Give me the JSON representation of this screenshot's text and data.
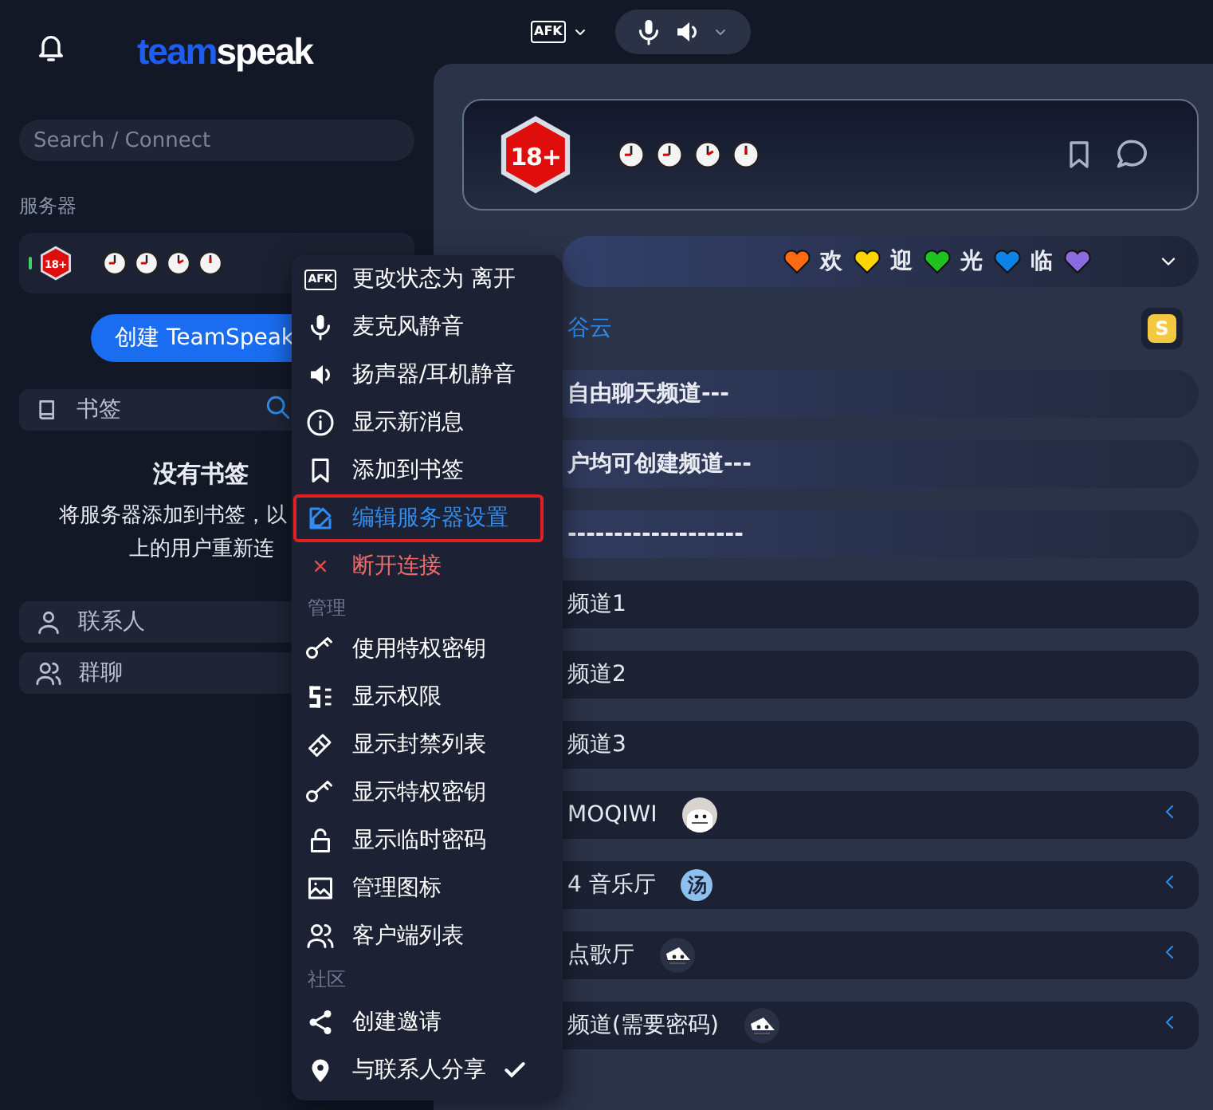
{
  "sidebar": {
    "logo": {
      "first": "team",
      "second": "speak"
    },
    "search": {
      "placeholder": "Search / Connect"
    },
    "servers_label": "服务器",
    "server": {
      "badge": "18+"
    },
    "create_button": "创建 TeamSpeak",
    "bookmarks": {
      "title": "书签",
      "empty_title": "没有书签",
      "empty_lines": [
        "将服务器添加到书签，以",
        "上的用户重新连"
      ]
    },
    "sections": [
      {
        "label": "联系人"
      },
      {
        "label": "群聊"
      }
    ]
  },
  "topbar": {
    "status_label": "AFK"
  },
  "server_header": {
    "badge": "18+"
  },
  "banner": {
    "segments": [
      {
        "kind": "heart",
        "color": "#ff6a13"
      },
      {
        "kind": "text",
        "text": "欢"
      },
      {
        "kind": "heart",
        "color": "#ffd500"
      },
      {
        "kind": "text",
        "text": "迎"
      },
      {
        "kind": "heart",
        "color": "#1fc31f"
      },
      {
        "kind": "text",
        "text": "光"
      },
      {
        "kind": "heart",
        "color": "#0a84e8"
      },
      {
        "kind": "text",
        "text": "临"
      },
      {
        "kind": "heart",
        "color": "#8c6be0"
      }
    ]
  },
  "channels": [
    {
      "kind": "server",
      "name": "谷云",
      "badge": "S"
    },
    {
      "kind": "spacer",
      "name": "自由聊天频道---"
    },
    {
      "kind": "spacer",
      "name": "户均可创建频道---"
    },
    {
      "kind": "spacer",
      "name": "-------------------"
    },
    {
      "kind": "channel",
      "name": "频道1",
      "collapsed": false
    },
    {
      "kind": "channel",
      "name": "频道2",
      "collapsed": false
    },
    {
      "kind": "channel",
      "name": "频道3",
      "collapsed": false
    },
    {
      "kind": "channel",
      "name": "MOQIWI",
      "collapsed": true
    },
    {
      "kind": "channel",
      "name": "4 音乐厅",
      "collapsed": true,
      "avatar": {
        "kind": "letter",
        "text": "汤"
      }
    },
    {
      "kind": "channel",
      "name": "点歌厅",
      "collapsed": true
    },
    {
      "kind": "channel",
      "name": "频道(需要密码)",
      "collapsed": true
    }
  ],
  "menu": {
    "items": [
      {
        "kind": "action",
        "label": "更改状态为 离开",
        "icon_text": "AFK",
        "selected": false,
        "checked": false
      },
      {
        "kind": "action",
        "label": "麦克风静音",
        "selected": false,
        "checked": false
      },
      {
        "kind": "action",
        "label": "扬声器/耳机静音",
        "selected": false,
        "checked": false
      },
      {
        "kind": "action",
        "label": "显示新消息",
        "selected": false,
        "checked": false
      },
      {
        "kind": "action",
        "label": "添加到书签",
        "selected": false,
        "checked": false
      },
      {
        "kind": "action",
        "label": "编辑服务器设置",
        "selected": true,
        "checked": false
      },
      {
        "kind": "danger",
        "label": "断开连接",
        "selected": false,
        "checked": false
      },
      {
        "kind": "section",
        "label": "管理"
      },
      {
        "kind": "action",
        "label": "使用特权密钥",
        "selected": false,
        "checked": false
      },
      {
        "kind": "action",
        "label": "显示权限",
        "selected": false,
        "checked": false
      },
      {
        "kind": "action",
        "label": "显示封禁列表",
        "selected": false,
        "checked": false
      },
      {
        "kind": "action",
        "label": "显示特权密钥",
        "selected": false,
        "checked": false
      },
      {
        "kind": "action",
        "label": "显示临时密码",
        "selected": false,
        "checked": false
      },
      {
        "kind": "action",
        "label": "管理图标",
        "selected": false,
        "checked": false
      },
      {
        "kind": "action",
        "label": "客户端列表",
        "selected": false,
        "checked": false
      },
      {
        "kind": "section",
        "label": "社区"
      },
      {
        "kind": "action",
        "label": "创建邀请",
        "selected": false,
        "checked": false
      },
      {
        "kind": "action",
        "label": "与联系人分享",
        "selected": false,
        "checked": true
      }
    ]
  }
}
